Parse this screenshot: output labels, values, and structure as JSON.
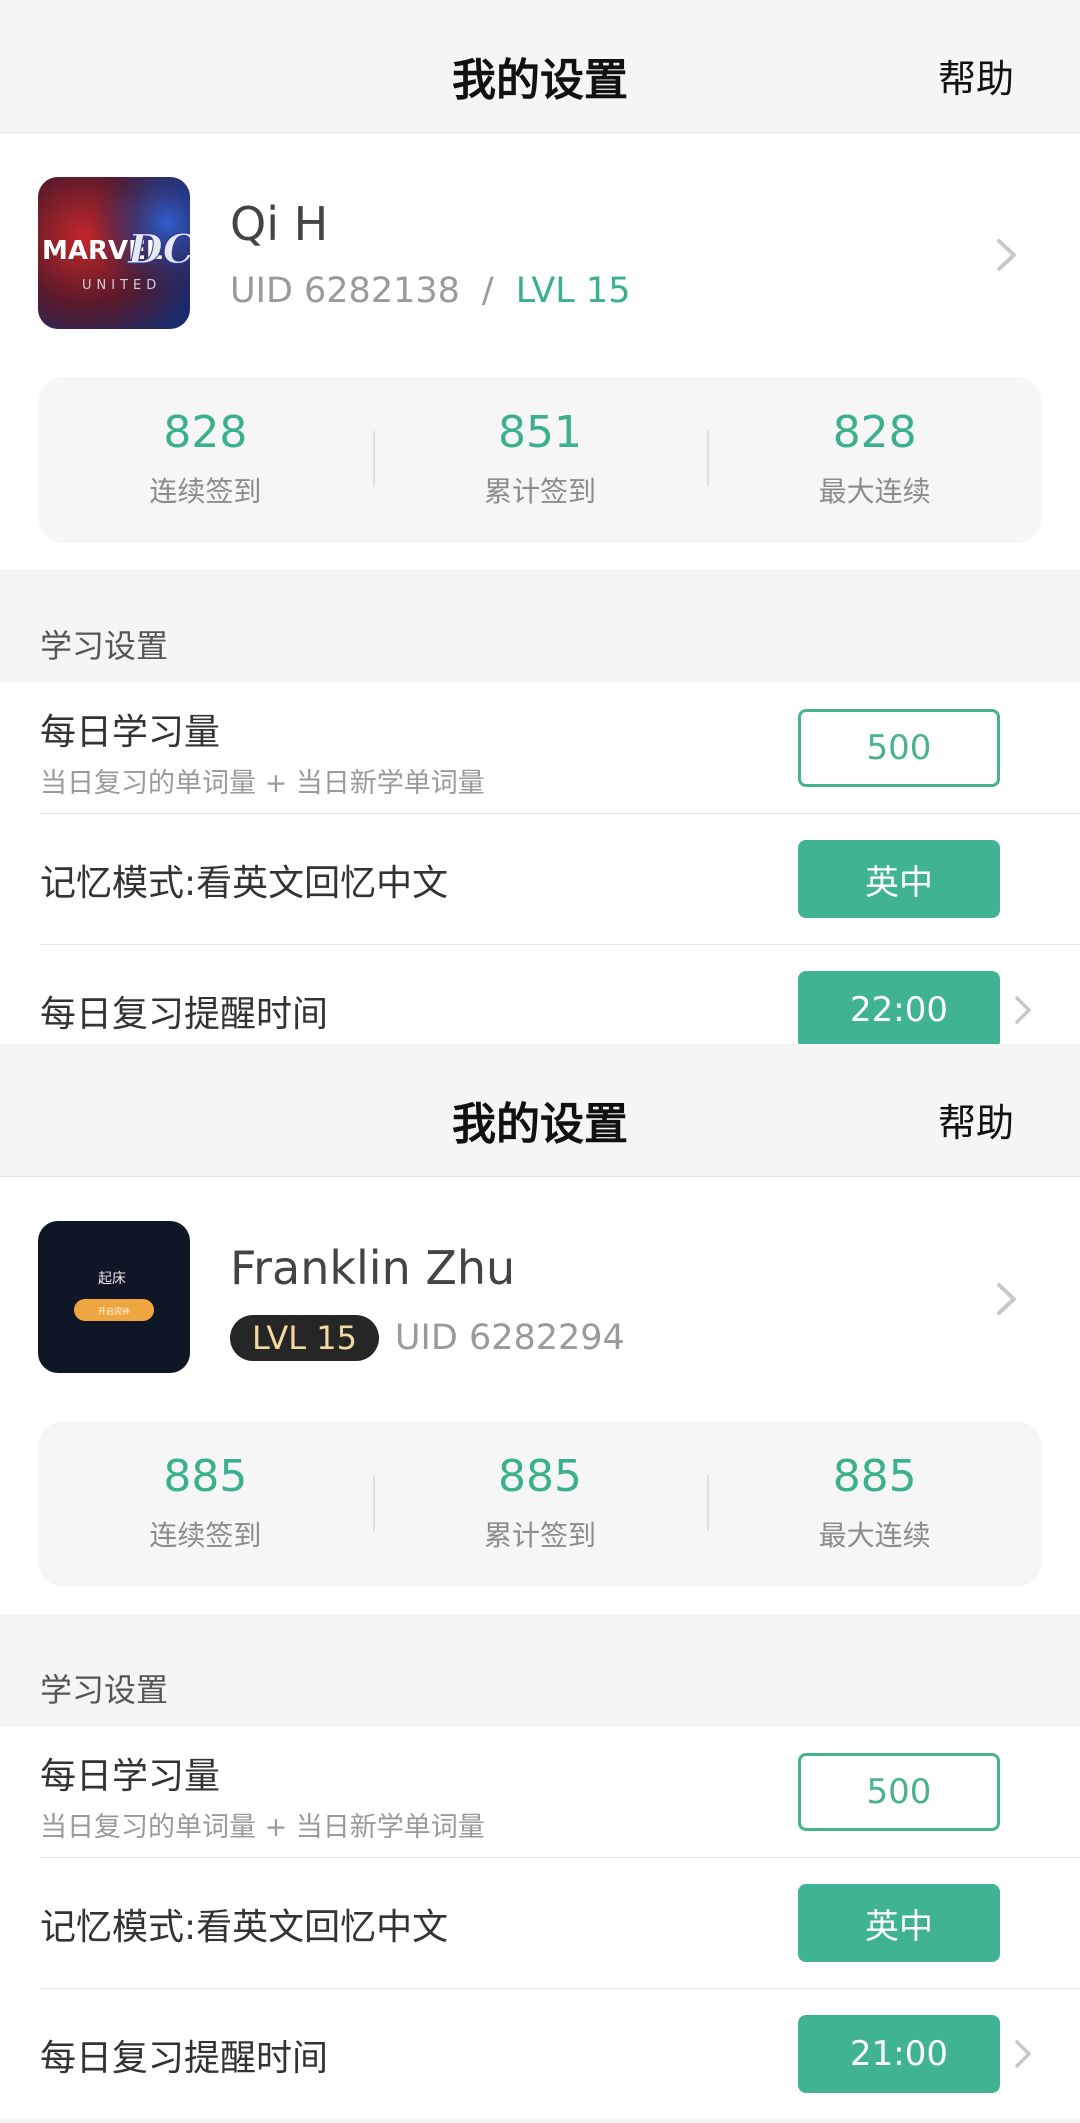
{
  "panels": [
    {
      "header": {
        "title": "我的设置",
        "help": "帮助"
      },
      "profile": {
        "name": "Qi H",
        "uid": "UID 6282138",
        "separator": "/",
        "level": "LVL 15",
        "avatar_brand": "MARVEL",
        "avatar_brand2": "DC",
        "avatar_sub": "UNITED"
      },
      "stats": [
        {
          "value": "828",
          "label": "连续签到"
        },
        {
          "value": "851",
          "label": "累计签到"
        },
        {
          "value": "828",
          "label": "最大连续"
        }
      ],
      "section_label": "学习设置",
      "settings": {
        "daily_amount": {
          "title": "每日学习量",
          "subtitle": "当日复习的单词量 + 当日新学单词量",
          "value": "500"
        },
        "memory_mode": {
          "title": "记忆模式:看英文回忆中文",
          "value": "英中"
        },
        "reminder": {
          "title": "每日复习提醒时间",
          "value": "22:00"
        }
      }
    },
    {
      "header": {
        "title": "我的设置",
        "help": "帮助"
      },
      "profile": {
        "name": "Franklin Zhu",
        "uid": "UID 6282294",
        "level": "LVL 15",
        "avatar_text": "起床",
        "avatar_button": "开启闹钟"
      },
      "stats": [
        {
          "value": "885",
          "label": "连续签到"
        },
        {
          "value": "885",
          "label": "累计签到"
        },
        {
          "value": "885",
          "label": "最大连续"
        }
      ],
      "section_label": "学习设置",
      "settings": {
        "daily_amount": {
          "title": "每日学习量",
          "subtitle": "当日复习的单词量 + 当日新学单词量",
          "value": "500"
        },
        "memory_mode": {
          "title": "记忆模式:看英文回忆中文",
          "value": "英中"
        },
        "reminder": {
          "title": "每日复习提醒时间",
          "value": "21:00"
        }
      }
    }
  ],
  "colors": {
    "accent": "#3bb08f",
    "badge_bg": "#262626",
    "badge_text": "#f3d9a2"
  }
}
